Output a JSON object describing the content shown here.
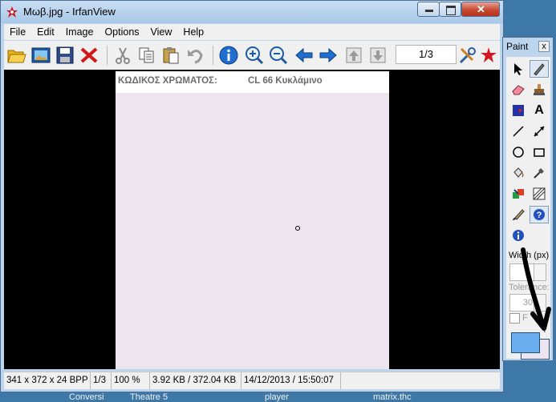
{
  "window": {
    "title": "Μωβ.jpg - IrfanView",
    "min_glyph": "—",
    "max_glyph": "☐",
    "close_glyph": "✕"
  },
  "menu": [
    "File",
    "Edit",
    "Image",
    "Options",
    "View",
    "Help"
  ],
  "toolbar": {
    "tools": [
      "open-folder",
      "slideshow",
      "save",
      "delete",
      "cut",
      "copy",
      "paste",
      "undo",
      "info",
      "zoom-in",
      "zoom-out",
      "previous",
      "next",
      "page-up",
      "page-down"
    ],
    "page_indicator": "1/3"
  },
  "image": {
    "header_label": "ΚΩΔΙΚΟΣ ΧΡΩΜΑΤΟΣ:",
    "header_value": "CL 66 Κυκλάμινο",
    "swatch_color": "#ece4ee"
  },
  "status": {
    "dimensions": "341 x 372 x 24 BPP",
    "page": "1/3",
    "zoom": "100 %",
    "size": "3.92 KB / 372.04 KB",
    "datetime": "14/12/2013 / 15:50:07"
  },
  "paint": {
    "title": "Paint",
    "close": "x",
    "width_label": "Width (px)",
    "tolerance_label": "Tolerance:",
    "tolerance_value": "30",
    "fill_label": "F",
    "fg_color": "#6aaef0",
    "bg_color": "#ece4ee"
  },
  "desktop": {
    "labels": [
      "Conversi",
      "Theatre 5",
      "player",
      "matrix.thc"
    ]
  }
}
